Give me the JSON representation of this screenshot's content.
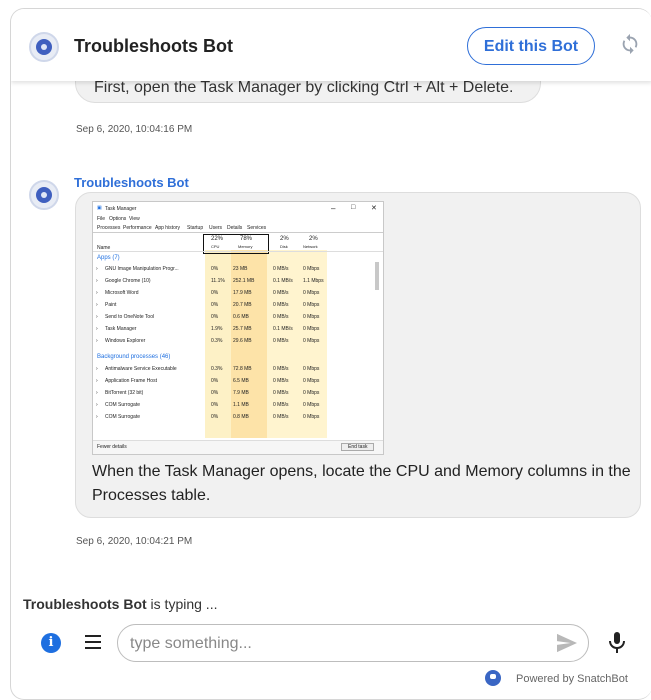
{
  "header": {
    "bot_name": "Troubleshoots Bot",
    "edit_button": "Edit this Bot",
    "refresh_icon": "refresh-icon"
  },
  "messages": {
    "previous_text": "First, open the Task Manager by clicking Ctrl + Alt + Delete.",
    "timestamp_1": "Sep 6, 2020, 10:04:16 PM",
    "sender": "Troubleshoots Bot",
    "text": "When the Task Manager opens, locate the CPU and Memory columns in the Processes table.",
    "timestamp_2": "Sep 6, 2020, 10:04:21 PM"
  },
  "task_manager": {
    "title": "Task Manager",
    "menu": [
      "File",
      "Options",
      "View"
    ],
    "tabs": [
      "Processes",
      "Performance",
      "App history",
      "Startup",
      "Users",
      "Details",
      "Services"
    ],
    "columns": [
      {
        "pct": "22%",
        "label": "CPU"
      },
      {
        "pct": "78%",
        "label": "Memory"
      },
      {
        "pct": "2%",
        "label": "Disk"
      },
      {
        "pct": "2%",
        "label": "Network"
      }
    ],
    "name_header": "Name",
    "apps_header": "Apps (7)",
    "apps": [
      {
        "name": "GNU Image Manipulation Progr...",
        "cpu": "0%",
        "mem": "23 MB",
        "disk": "0 MB/s",
        "net": "0 Mbps"
      },
      {
        "name": "Google Chrome (10)",
        "cpu": "11.1%",
        "mem": "252.1 MB",
        "disk": "0.1 MB/s",
        "net": "1.1 Mbps"
      },
      {
        "name": "Microsoft Word",
        "cpu": "0%",
        "mem": "17.9 MB",
        "disk": "0 MB/s",
        "net": "0 Mbps"
      },
      {
        "name": "Paint",
        "cpu": "0%",
        "mem": "20.7 MB",
        "disk": "0 MB/s",
        "net": "0 Mbps"
      },
      {
        "name": "Send to OneNote Tool",
        "cpu": "0%",
        "mem": "0.6 MB",
        "disk": "0 MB/s",
        "net": "0 Mbps"
      },
      {
        "name": "Task Manager",
        "cpu": "1.9%",
        "mem": "25.7 MB",
        "disk": "0.1 MB/s",
        "net": "0 Mbps"
      },
      {
        "name": "Windows Explorer",
        "cpu": "0.3%",
        "mem": "29.6 MB",
        "disk": "0 MB/s",
        "net": "0 Mbps"
      }
    ],
    "bg_header": "Background processes (46)",
    "background": [
      {
        "name": "Antimalware Service Executable",
        "cpu": "0.3%",
        "mem": "72.8 MB",
        "disk": "0 MB/s",
        "net": "0 Mbps"
      },
      {
        "name": "Application Frame Host",
        "cpu": "0%",
        "mem": "6.5 MB",
        "disk": "0 MB/s",
        "net": "0 Mbps"
      },
      {
        "name": "BitTorrent (32 bit)",
        "cpu": "0%",
        "mem": "7.9 MB",
        "disk": "0 MB/s",
        "net": "0 Mbps"
      },
      {
        "name": "COM Surrogate",
        "cpu": "0%",
        "mem": "1.1 MB",
        "disk": "0 MB/s",
        "net": "0 Mbps"
      },
      {
        "name": "COM Surrogate",
        "cpu": "0%",
        "mem": "0.8 MB",
        "disk": "0 MB/s",
        "net": "0 Mbps"
      }
    ],
    "fewer_details": "Fewer details",
    "end_task": "End task"
  },
  "footer": {
    "typing_name": "Troubleshoots Bot",
    "typing_suffix": " is typing ...",
    "input_placeholder": "type something...",
    "powered_by": "Powered by SnatchBot"
  },
  "colors": {
    "accent": "#2f6fd8",
    "cpu_highlight": "#fbe7a6",
    "mem_highlight": "#f8c978"
  }
}
